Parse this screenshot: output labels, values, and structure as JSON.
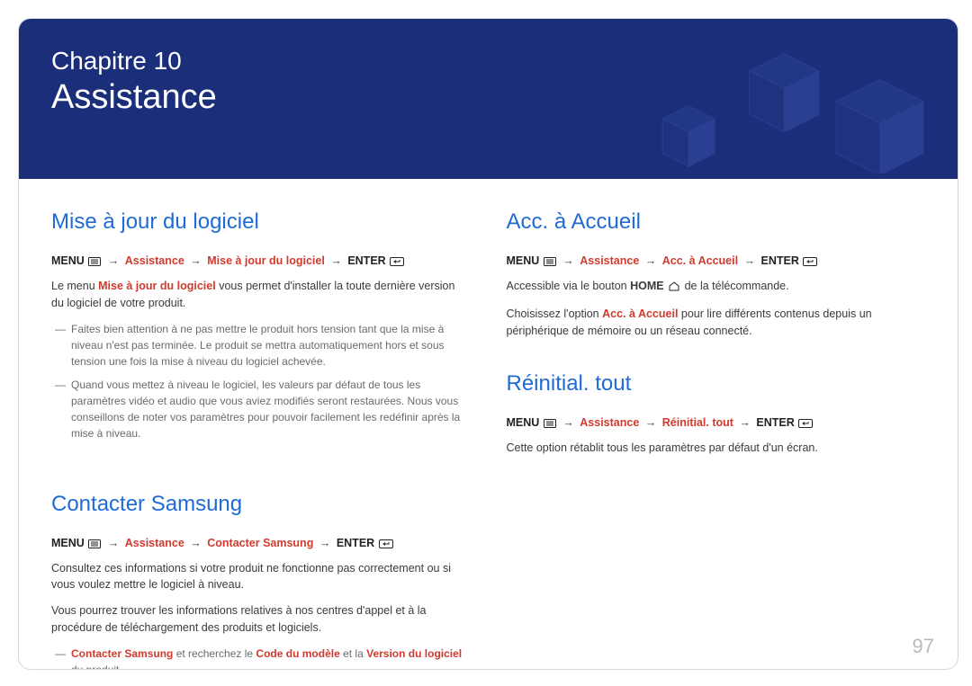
{
  "hero": {
    "chapter_label": "Chapitre 10",
    "title": "Assistance"
  },
  "page_number": "97",
  "left": {
    "update": {
      "heading": "Mise à jour du logiciel",
      "path": {
        "p1": "MENU",
        "p2": "Assistance",
        "p3": "Mise à jour du logiciel",
        "p4": "ENTER"
      },
      "body1a": "Le menu ",
      "body1b": "Mise à jour du logiciel",
      "body1c": " vous permet d'installer la toute dernière version du logiciel de votre produit.",
      "note1": "Faites bien attention à ne pas mettre le produit hors tension tant que la mise à niveau n'est pas terminée. Le produit se mettra automatiquement hors et sous tension une fois la mise à niveau du logiciel achevée.",
      "note2": "Quand vous mettez à niveau le logiciel, les valeurs par défaut de tous les paramètres vidéo et audio que vous aviez modifiés seront restaurées. Nous vous conseillons de noter vos paramètres pour pouvoir facilement les redéfinir après la mise à niveau."
    },
    "contact": {
      "heading": "Contacter Samsung",
      "path": {
        "p1": "MENU",
        "p2": "Assistance",
        "p3": "Contacter Samsung",
        "p4": "ENTER"
      },
      "body1": "Consultez ces informations si votre produit ne fonctionne pas correctement ou si vous voulez mettre le logiciel à niveau.",
      "body2": "Vous pourrez trouver les informations relatives à nos centres d'appel et à la procédure de téléchargement des produits et logiciels.",
      "note1a": "Contacter Samsung",
      "note1b": " et recherchez le ",
      "note1c": "Code du modèle",
      "note1d": " et la ",
      "note1e": "Version du logiciel",
      "note1f": " du produit."
    }
  },
  "right": {
    "home": {
      "heading": "Acc. à Accueil",
      "path": {
        "p1": "MENU",
        "p2": "Assistance",
        "p3": "Acc. à Accueil",
        "p4": "ENTER"
      },
      "body1a": "Accessible via le bouton ",
      "body1b": "HOME",
      "body1c": " de la télécommande.",
      "body2a": "Choisissez l'option ",
      "body2b": "Acc. à Accueil",
      "body2c": " pour lire différents contenus depuis un périphérique de mémoire ou un réseau connecté."
    },
    "reset": {
      "heading": "Réinitial. tout",
      "path": {
        "p1": "MENU",
        "p2": "Assistance",
        "p3": "Réinitial. tout",
        "p4": "ENTER"
      },
      "body1": "Cette option rétablit tous les paramètres par défaut d'un écran."
    }
  }
}
